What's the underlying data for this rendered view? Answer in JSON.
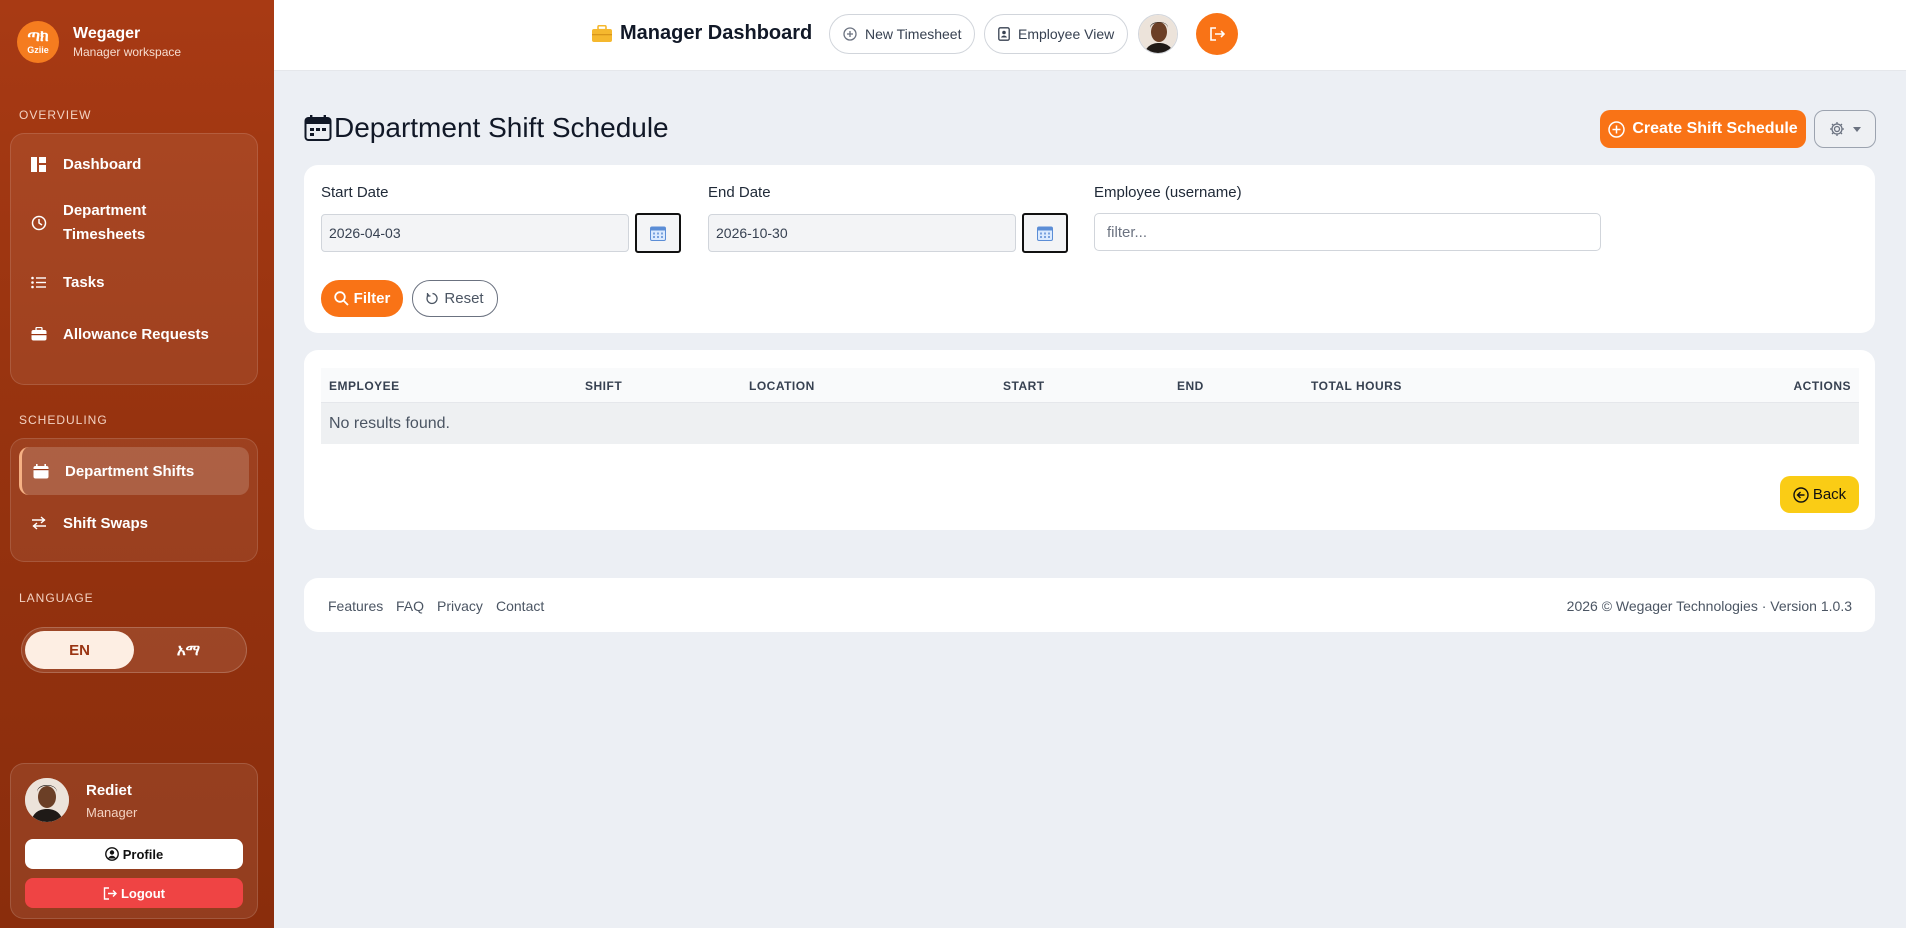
{
  "brand": {
    "name": "Wegager",
    "subtitle": "Manager workspace",
    "logo_glyph": "ጣክ",
    "logo_text": "Gziie"
  },
  "sidebar": {
    "overview_title": "OVERVIEW",
    "overview_items": [
      {
        "label": "Dashboard",
        "icon": "dashboard-icon"
      },
      {
        "label": "Department\nTimesheets",
        "icon": "clock-icon"
      },
      {
        "label": "Tasks",
        "icon": "list-icon"
      },
      {
        "label": "Allowance Requests",
        "icon": "briefcase-icon"
      }
    ],
    "scheduling_title": "SCHEDULING",
    "scheduling_items": [
      {
        "label": "Department Shifts",
        "icon": "calendar-icon",
        "active": true
      },
      {
        "label": "Shift Swaps",
        "icon": "swap-icon"
      }
    ],
    "language_title": "LANGUAGE",
    "languages": [
      "EN",
      "አማ"
    ],
    "active_language": "EN"
  },
  "user": {
    "name": "Rediet",
    "role": "Manager",
    "profile_label": "Profile",
    "logout_label": "Logout"
  },
  "topbar": {
    "title": "Manager Dashboard",
    "new_timesheet": "New Timesheet",
    "employee_view": "Employee View"
  },
  "page": {
    "title": "Department Shift Schedule",
    "create_label": "Create Shift Schedule"
  },
  "filters": {
    "start_label": "Start Date",
    "start_value": "2026-04-03",
    "end_label": "End Date",
    "end_value": "2026-10-30",
    "employee_label": "Employee (username)",
    "employee_placeholder": "filter...",
    "filter_label": "Filter",
    "reset_label": "Reset"
  },
  "table": {
    "columns": [
      "EMPLOYEE",
      "SHIFT",
      "LOCATION",
      "START",
      "END",
      "TOTAL HOURS",
      "ACTIONS"
    ],
    "empty": "No results found."
  },
  "back_label": "Back",
  "footer": {
    "links": [
      "Features",
      "FAQ",
      "Privacy",
      "Contact"
    ],
    "copyright": "2026 © Wegager Technologies · Version 1.0.3"
  },
  "colors": {
    "accent": "#f97316",
    "sidebar": "#a83a14",
    "danger": "#ef4444",
    "back": "#facc15"
  }
}
